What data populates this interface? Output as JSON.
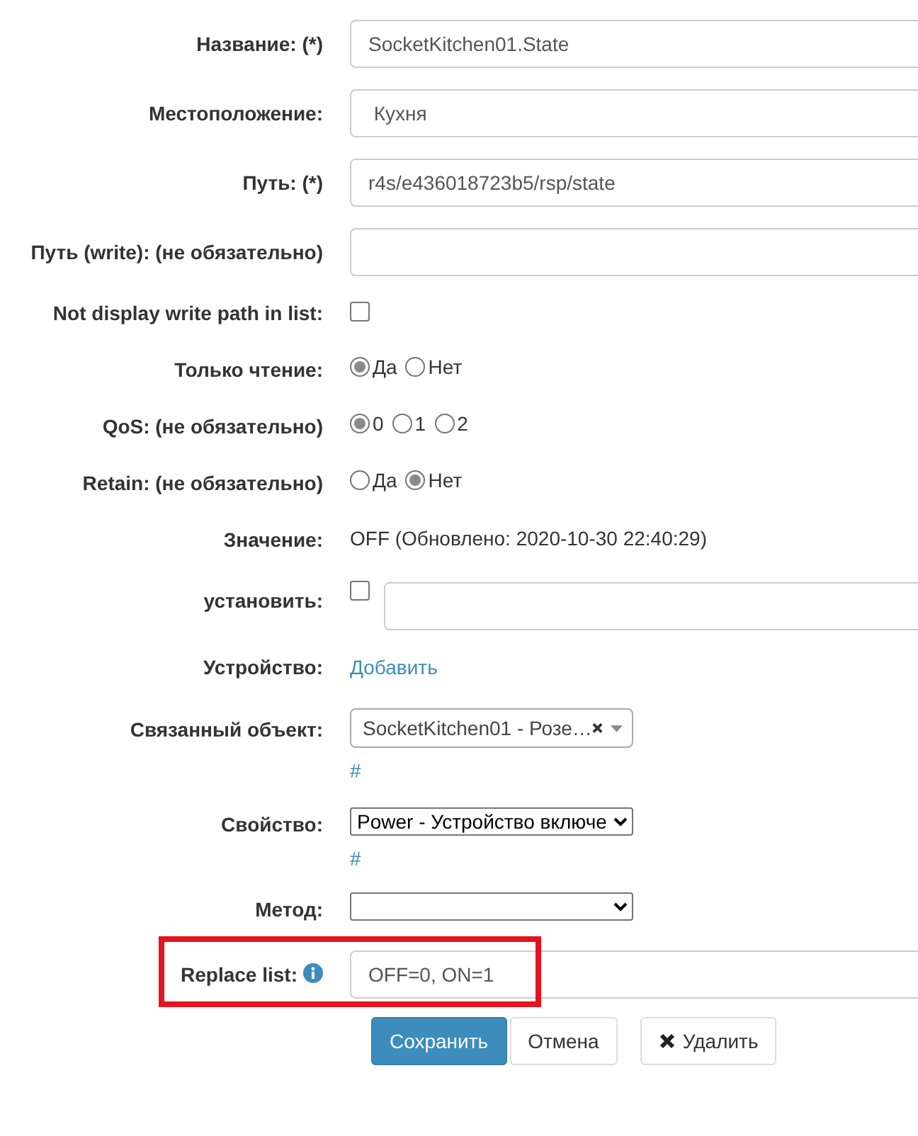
{
  "fields": [
    {
      "kind": "text",
      "label": "Название: (*)",
      "value": "SocketKitchen01.State"
    },
    {
      "kind": "text",
      "label": "Местоположение:",
      "value": " Кухня"
    },
    {
      "kind": "text",
      "label": "Путь: (*)",
      "value": "r4s/e436018723b5/rsp/state"
    },
    {
      "kind": "text",
      "label": "Путь (write): (не обязательно)"
    },
    {
      "kind": "checkbox",
      "label": "Not display write path in list:",
      "checked": false
    },
    {
      "kind": "radio",
      "label": "Только чтение:",
      "options": [
        {
          "label": "Да",
          "selected": true
        },
        {
          "label": "Нет",
          "selected": false
        }
      ]
    },
    {
      "kind": "radio",
      "label": "QoS: (не обязательно)",
      "options": [
        {
          "label": "0",
          "selected": true
        },
        {
          "label": "1",
          "selected": false
        },
        {
          "label": "2",
          "selected": false
        }
      ]
    },
    {
      "kind": "radio",
      "label": "Retain: (не обязательно)",
      "options": [
        {
          "label": "Да",
          "selected": false
        },
        {
          "label": "Нет",
          "selected": true
        }
      ]
    },
    {
      "kind": "static",
      "label": "Значение:",
      "value": "OFF (Обновлено: 2020-10-30 22:40:29)"
    },
    {
      "kind": "checkbox_text",
      "label": "установить:",
      "checked": false
    },
    {
      "kind": "link",
      "label": "Устройство:",
      "link": "Добавить"
    },
    {
      "kind": "combo",
      "label": "Связанный объект:",
      "value": "SocketKitchen01 - Розе…",
      "link": "#"
    },
    {
      "kind": "select",
      "label": "Свойство:",
      "value": "Power - Устройство включе",
      "link": "#"
    },
    {
      "kind": "select",
      "label": "Метод:"
    },
    {
      "kind": "text",
      "label": "Replace list:",
      "value": "OFF=0, ON=1",
      "info": true,
      "highlighted": true
    }
  ],
  "buttons": [
    {
      "kind": "primary",
      "label": "Сохранить"
    },
    {
      "kind": "default",
      "label": "Отмена"
    },
    {
      "kind": "delete",
      "label": "Удалить"
    }
  ]
}
